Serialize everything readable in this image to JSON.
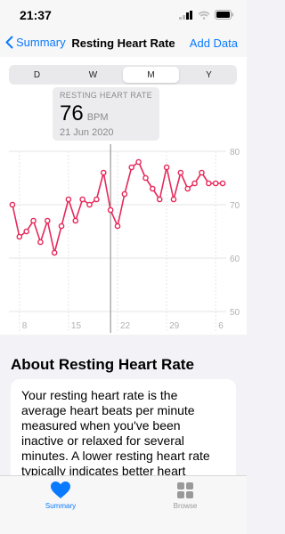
{
  "status_bar": {
    "time": "21:37"
  },
  "nav": {
    "back_label": "Summary",
    "title": "Resting Heart Rate",
    "action_label": "Add Data"
  },
  "segments": {
    "d": "D",
    "w": "W",
    "m": "M",
    "y": "Y",
    "selected": "M"
  },
  "tooltip": {
    "label": "RESTING HEART RATE",
    "value": "76",
    "unit": "BPM",
    "date": "21 Jun 2020"
  },
  "chart_data": {
    "type": "line",
    "x_tick_labels": [
      "8",
      "15",
      "22",
      "29",
      "6"
    ],
    "y_tick_labels": [
      "80",
      "70",
      "60",
      "50"
    ],
    "ylim": [
      50,
      80
    ],
    "x": [
      7,
      8,
      9,
      10,
      11,
      12,
      13,
      14,
      15,
      16,
      17,
      18,
      19,
      20,
      21,
      22,
      23,
      24,
      25,
      26,
      27,
      28,
      29,
      30,
      31,
      32,
      33,
      34,
      35,
      36,
      37
    ],
    "values": [
      70,
      64,
      65,
      67,
      63,
      67,
      61,
      66,
      71,
      67,
      71,
      70,
      71,
      76,
      69,
      66,
      72,
      77,
      78,
      75,
      73,
      71,
      77,
      71,
      76,
      73,
      74,
      76,
      74,
      74,
      74
    ],
    "selected_x": 21,
    "line_color": "#e6295a",
    "grid": true
  },
  "about": {
    "title": "About Resting Heart Rate",
    "text": "Your resting heart rate is the average heart beats per minute measured when you've been inactive or relaxed for several minutes. A lower resting heart rate typically indicates better heart"
  },
  "tabs": {
    "summary_label": "Summary",
    "browse_label": "Browse",
    "active": "summary"
  },
  "colors": {
    "accent": "#0a7aff",
    "heart": "#0a7aff",
    "line": "#e6295a"
  }
}
